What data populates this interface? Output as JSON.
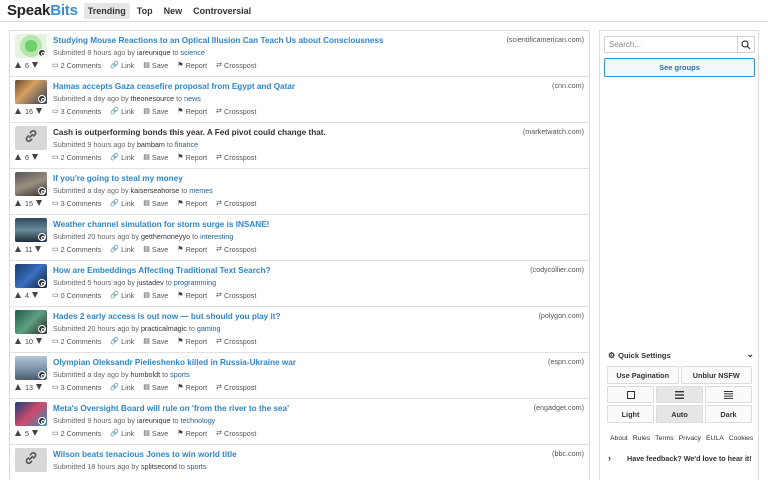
{
  "header": {
    "logo_main": "Speak",
    "logo_accent": "Bits",
    "tabs": [
      "Trending",
      "Top",
      "New",
      "Controversial"
    ],
    "active_tab": "Trending"
  },
  "actions": {
    "link": "Link",
    "save": "Save",
    "report": "Report",
    "crosspost": "Crosspost"
  },
  "posts": [
    {
      "title": "Studying Mouse Reactions to an Optical Illusion Can Teach Us about Consciousness",
      "domain": "(scientificamerican.com)",
      "time": "8 hours ago",
      "user": "iareunique",
      "community": "science",
      "votes": "6",
      "comments": "2 Comments",
      "thumb": "illusion"
    },
    {
      "title": "Hamas accepts Gaza ceasefire proposal from Egypt and Qatar",
      "domain": "(cnn.com)",
      "time": "a day ago",
      "user": "theonesource",
      "community": "news",
      "votes": "16",
      "comments": "3 Comments",
      "thumb": "news"
    },
    {
      "title": "Cash is outperforming bonds this year. A Fed pivot could change that.",
      "domain": "(marketwatch.com)",
      "time": "9 hours ago",
      "user": "bambam",
      "community": "finance",
      "votes": "6",
      "comments": "2 Comments",
      "thumb": "link"
    },
    {
      "title": "If you're going to steal my money",
      "domain": "",
      "time": "a day ago",
      "user": "kaiserseahorse",
      "community": "memes",
      "votes": "15",
      "comments": "3 Comments",
      "thumb": "meme"
    },
    {
      "title": "Weather channel simulation for storm surge is INSANE!",
      "domain": "",
      "time": "20 hours ago",
      "user": "getthemoneyyo",
      "community": "interesting",
      "votes": "11",
      "comments": "2 Comments",
      "thumb": "weather"
    },
    {
      "title": "How are Embeddings Affecting Traditional Text Search?",
      "domain": "(codycollier.com)",
      "time": "5 hours ago",
      "user": "justadev",
      "community": "programming",
      "votes": "4",
      "comments": "0 Comments",
      "thumb": "code"
    },
    {
      "title": "Hades 2 early access is out now — but should you play it?",
      "domain": "(polygon.com)",
      "time": "20 hours ago",
      "user": "practicalmagic",
      "community": "gaming",
      "votes": "10",
      "comments": "2 Comments",
      "thumb": "game"
    },
    {
      "title": "Olympian Oleksandr Pielieshenko killed in Russia-Ukraine war",
      "domain": "(espn.com)",
      "time": "a day ago",
      "user": "humboldt",
      "community": "sports",
      "votes": "13",
      "comments": "3 Comments",
      "thumb": "sport"
    },
    {
      "title": "Meta's Oversight Board will rule on 'from the river to the sea'",
      "domain": "(engadget.com)",
      "time": "9 hours ago",
      "user": "iareunique",
      "community": "technology",
      "votes": "5",
      "comments": "2 Comments",
      "thumb": "tech"
    },
    {
      "title": "Wilson beats tenacious Jones to win world title",
      "domain": "(bbc.com)",
      "time": "18 hours ago",
      "user": "splitsecond",
      "community": "sports",
      "votes": "",
      "comments": "",
      "thumb": "link"
    }
  ],
  "meta": {
    "submitted": "Submitted",
    "by": "by",
    "to": "to"
  },
  "sidebar": {
    "search_placeholder": "Search...",
    "groups_button": "See groups",
    "quick_settings": "Quick Settings",
    "use_pagination": "Use Pagination",
    "unblur_nsfw": "Unblur NSFW",
    "light": "Light",
    "auto": "Auto",
    "dark": "Dark",
    "links": [
      "About",
      "Rules",
      "Terms",
      "Privacy",
      "EULA",
      "Cookies"
    ],
    "feedback": "Have feedback? We'd love to hear it!"
  },
  "colors": {
    "accent": "#3a8fd0",
    "title_link": "#2f86c8"
  }
}
